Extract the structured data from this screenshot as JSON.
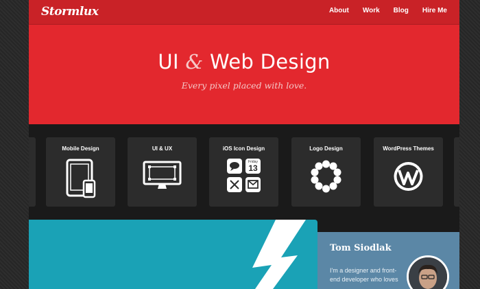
{
  "header": {
    "logo": "Stormlux",
    "nav": [
      "About",
      "Work",
      "Blog",
      "Hire Me"
    ]
  },
  "hero": {
    "title_part1": "UI",
    "title_amp": "&",
    "title_part2": "Web Design",
    "subtitle": "Every pixel placed with love."
  },
  "services": [
    {
      "label": "Mobile Design",
      "icon": "devices-icon"
    },
    {
      "label": "UI & UX",
      "icon": "monitor-icon"
    },
    {
      "label": "iOS Icon Design",
      "icon": "app-icons-grid-icon",
      "calendar_day": "Friday",
      "calendar_date": "13"
    },
    {
      "label": "Logo Design",
      "icon": "logo-circle-icon"
    },
    {
      "label": "WordPress Themes",
      "icon": "wordpress-icon"
    }
  ],
  "about": {
    "name": "Tom Siodlak",
    "text": "I'm a designer and front-end developer who loves"
  },
  "colors": {
    "header": "#c92227",
    "hero": "#e3282e",
    "tiles_bg": "#1a1a1a",
    "tile": "#2c2c2c",
    "promo": "#1aa2b6",
    "about": "#5b87a6"
  }
}
